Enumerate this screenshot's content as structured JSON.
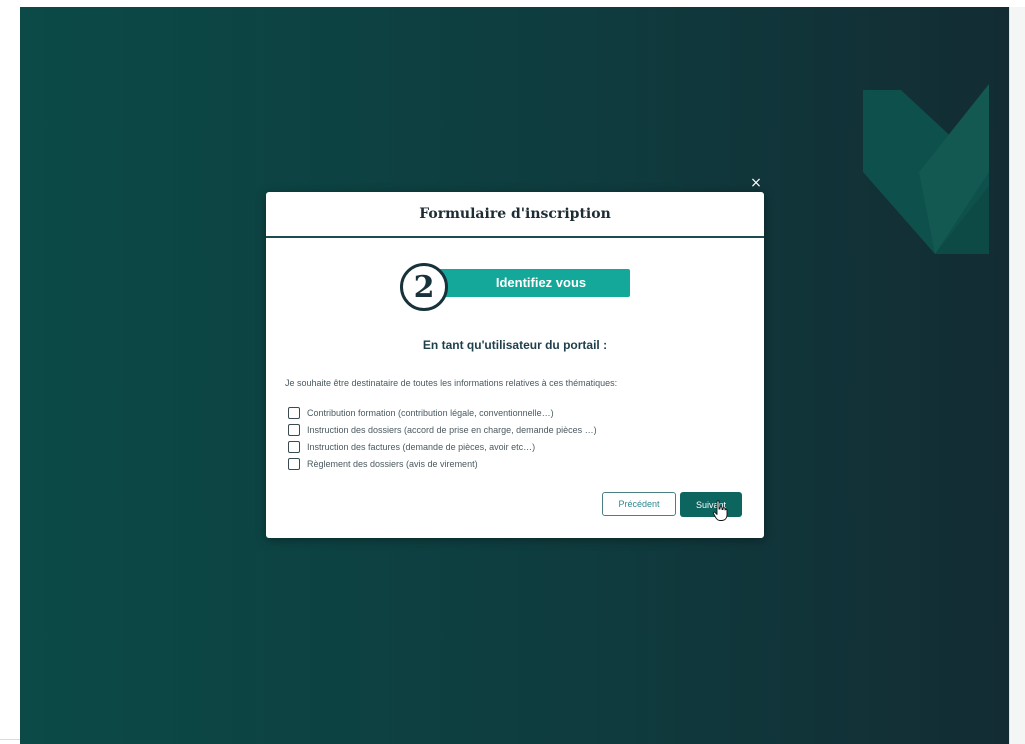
{
  "modal": {
    "close_icon": "×",
    "title": "Formulaire d'inscription",
    "step": {
      "number": "2",
      "label": "Identifiez vous"
    },
    "subtitle": "En tant qu'utilisateur du portail :",
    "intro": "Je souhaite être destinataire de toutes les informations relatives à ces thématiques:",
    "options": [
      {
        "label": "Contribution formation (contribution légale, conventionnelle…)",
        "checked": false
      },
      {
        "label": "Instruction des dossiers (accord de prise en charge, demande pièces …)",
        "checked": false
      },
      {
        "label": "Instruction des factures (demande de pièces, avoir etc…)",
        "checked": false
      },
      {
        "label": "Règlement des dossiers (avis de virement)",
        "checked": false
      }
    ],
    "buttons": {
      "previous": "Précédent",
      "next": "Suivant"
    }
  },
  "colors": {
    "backdrop_left": "#0b4a47",
    "backdrop_right": "#132c33",
    "accent": "#13a89a",
    "primary_button": "#0d6560"
  },
  "icons": [
    "brand-chevron-logo",
    "close-icon",
    "hand-pointer-cursor-icon"
  ]
}
